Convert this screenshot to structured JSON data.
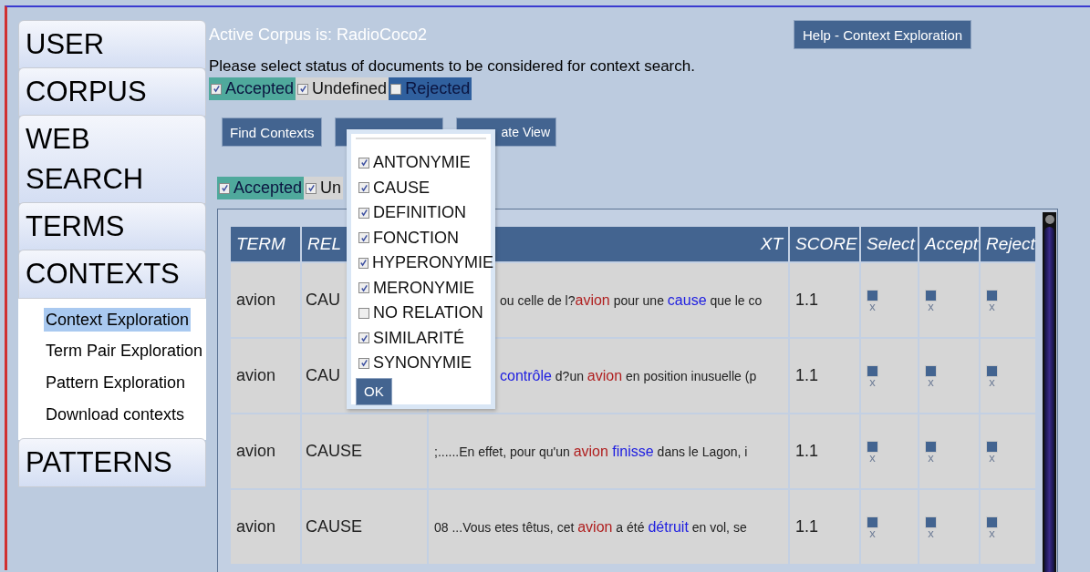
{
  "sidebar": {
    "items": [
      {
        "label": "USER"
      },
      {
        "label": "CORPUS"
      },
      {
        "label": "WEB SEARCH"
      },
      {
        "label": "TERMS"
      },
      {
        "label": "CONTEXTS",
        "children": [
          {
            "label": "Context Exploration",
            "selected": true
          },
          {
            "label": "Term Pair Exploration",
            "selected": false
          },
          {
            "label": "Pattern Exploration",
            "selected": false
          },
          {
            "label": "Download contexts",
            "selected": false
          }
        ]
      },
      {
        "label": "PATTERNS"
      }
    ]
  },
  "header": {
    "title": "Active Corpus is: RadioCoco2",
    "help_button": "Help - Context Exploration"
  },
  "instruction": "Please select status of documents to be considered for context search.",
  "status_filters": [
    {
      "label": "Accepted",
      "checked": true,
      "color": "#4fa99c"
    },
    {
      "label": "Undefined",
      "checked": true,
      "color": "#d4d4d4"
    },
    {
      "label": "Rejected",
      "checked": false,
      "color": "#30609e"
    }
  ],
  "buttons": [
    {
      "kind": "button",
      "label": "Find Contexts"
    },
    {
      "kind": "covered"
    },
    {
      "kind": "button",
      "label": "ate View"
    }
  ],
  "view_filters": [
    {
      "label": "Accepted",
      "checked": true,
      "color": "#4fa99c"
    },
    {
      "label": "Un",
      "checked": true,
      "color": "#d4d4d4"
    }
  ],
  "relation_popup": {
    "options": [
      {
        "label": "ANTONYMIE",
        "checked": true
      },
      {
        "label": "CAUSE",
        "checked": true
      },
      {
        "label": "DEFINITION",
        "checked": true
      },
      {
        "label": "FONCTION",
        "checked": true
      },
      {
        "label": "HYPERONYMIE",
        "checked": true
      },
      {
        "label": "MERONYMIE",
        "checked": true
      },
      {
        "label": "NO RELATION",
        "checked": false
      },
      {
        "label": "SIMILARITÉ",
        "checked": true
      },
      {
        "label": "SYNONYMIE",
        "checked": true
      }
    ],
    "ok_button": "OK"
  },
  "table": {
    "columns": [
      "TERM",
      "REL",
      "XT",
      "SCORE",
      "Select",
      "Accept",
      "Reject"
    ],
    "rows": [
      {
        "term": "avion",
        "relation": "CAU",
        "context": [
          {
            "kind": "text",
            "text": "ou celle de l?"
          },
          {
            "kind": "term",
            "text": "avion"
          },
          {
            "kind": "text",
            "text": " pour une "
          },
          {
            "kind": "marker",
            "text": "cause"
          },
          {
            "kind": "text",
            "text": " que le co"
          }
        ],
        "score": "1.1",
        "marks": [
          "x",
          "x",
          "x"
        ]
      },
      {
        "term": "avion",
        "relation": "CAU",
        "context": [
          {
            "kind": "marker",
            "text": "contrôle"
          },
          {
            "kind": "text",
            "text": " d?un "
          },
          {
            "kind": "term",
            "text": "avion"
          },
          {
            "kind": "text",
            "text": " en position inusuelle (p"
          }
        ],
        "score": "1.1",
        "marks": [
          "x",
          "x",
          "x"
        ]
      },
      {
        "term": "avion",
        "relation": "CAUSE",
        "context": [
          {
            "kind": "text",
            "text": ";......En effet, pour qu'un "
          },
          {
            "kind": "term",
            "text": "avion"
          },
          {
            "kind": "marker",
            "text": "finisse"
          },
          {
            "kind": "text",
            "text": " dans le Lagon, i"
          }
        ],
        "score": "1.1",
        "marks": [
          "x",
          "x",
          "x"
        ]
      },
      {
        "term": "avion",
        "relation": "CAUSE",
        "context": [
          {
            "kind": "text",
            "text": "08 ...Vous etes têtus, cet "
          },
          {
            "kind": "term",
            "text": "avion"
          },
          {
            "kind": "text",
            "text": " a été "
          },
          {
            "kind": "marker",
            "text": "détruit"
          },
          {
            "kind": "text",
            "text": " en vol, se"
          }
        ],
        "score": "1.1",
        "marks": [
          "x",
          "x",
          "x"
        ]
      }
    ]
  }
}
